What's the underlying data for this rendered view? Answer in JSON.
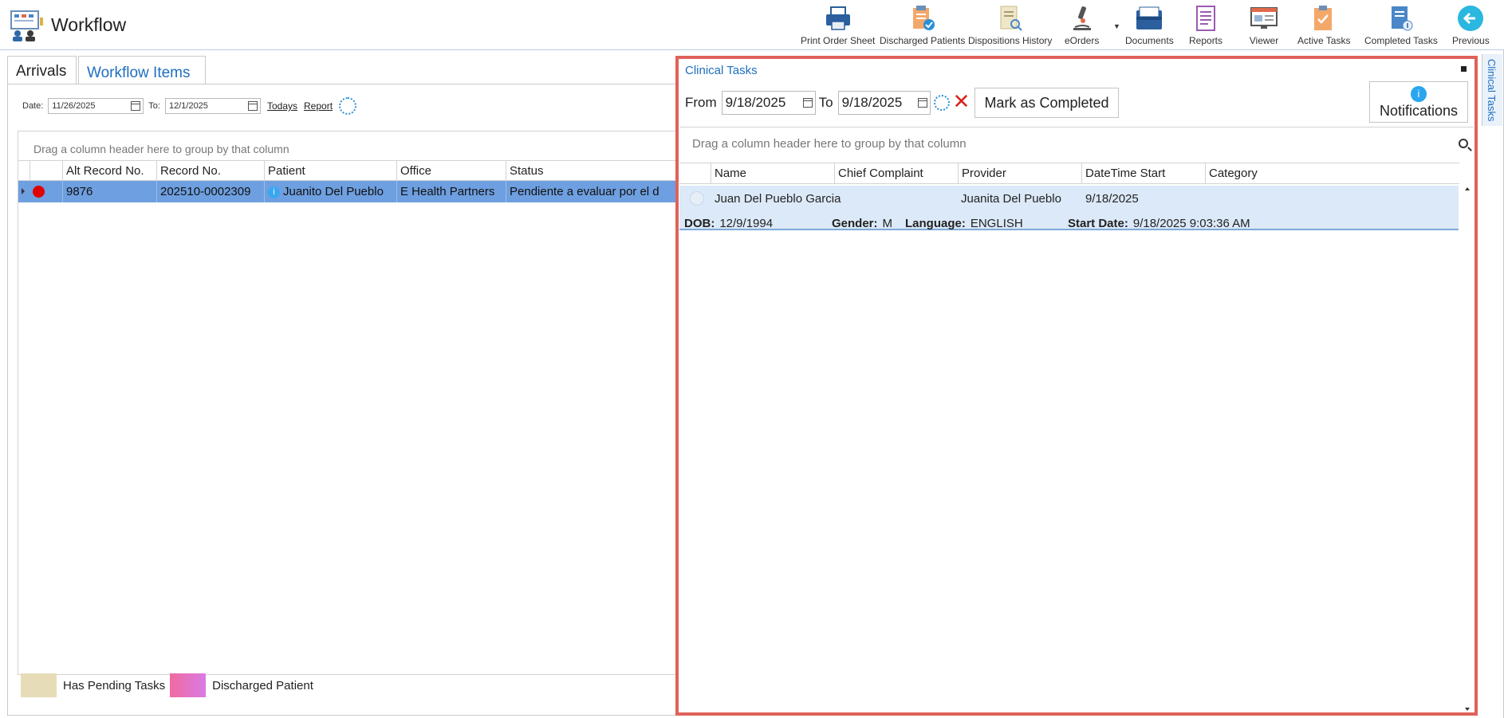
{
  "app": {
    "title": "Workflow"
  },
  "toolbar": {
    "print_order_sheet": "Print Order Sheet",
    "discharged_patients": "Discharged Patients",
    "dispositions_history": "Dispositions History",
    "eorders": "eOrders",
    "documents": "Documents",
    "reports": "Reports",
    "viewer": "Viewer",
    "active_tasks": "Active Tasks",
    "completed_tasks": "Completed Tasks",
    "previous": "Previous"
  },
  "tabs": {
    "arrivals": "Arrivals",
    "workflow_items": "Workflow Items"
  },
  "date_filter": {
    "date_label": "Date:",
    "date_value": "11/26/2025",
    "to_label": "To:",
    "to_value": "12/1/2025",
    "todays": "Todays",
    "report": "Report"
  },
  "left_grid": {
    "group_hint": "Drag a column header here to group by that column",
    "columns": [
      "Alt Record No.",
      "Record No.",
      "Patient",
      "Office",
      "Status"
    ],
    "rows": [
      {
        "alt_record_no": "9876",
        "record_no": "202510-0002309",
        "patient": "Juanito Del Pueblo",
        "office": "E Health Partners",
        "status": "Pendiente a evaluar por el d"
      }
    ]
  },
  "legend": {
    "pending": "Has Pending Tasks",
    "discharged": "Discharged Patient"
  },
  "clinical_tasks": {
    "title": "Clinical Tasks",
    "from_label": "From",
    "from_value": "9/18/2025",
    "to_label": "To",
    "to_value": "9/18/2025",
    "mark_completed": "Mark as Completed",
    "notifications": "Notifications",
    "group_hint": "Drag a column header here to group by that column",
    "columns": [
      "Name",
      "Chief Complaint",
      "Provider",
      "DateTime Start",
      "Category"
    ],
    "row": {
      "name": "Juan Del Pueblo Garcia",
      "chief_complaint": "",
      "provider": "Juanita Del Pueblo",
      "datetime_start": "9/18/2025",
      "category": "",
      "dob_label": "DOB:",
      "dob": "12/9/1994",
      "gender_label": "Gender:",
      "gender": "M",
      "language_label": "Language:",
      "language": "ENGLISH",
      "start_date_label": "Start Date:",
      "start_date": "9/18/2025 9:03:36 AM"
    }
  },
  "side_tab": {
    "label": "Clinical Tasks"
  },
  "colors": {
    "accent": "#1f6fbf",
    "highlight": "#e0625a",
    "row_selected": "#6e9fe0"
  }
}
